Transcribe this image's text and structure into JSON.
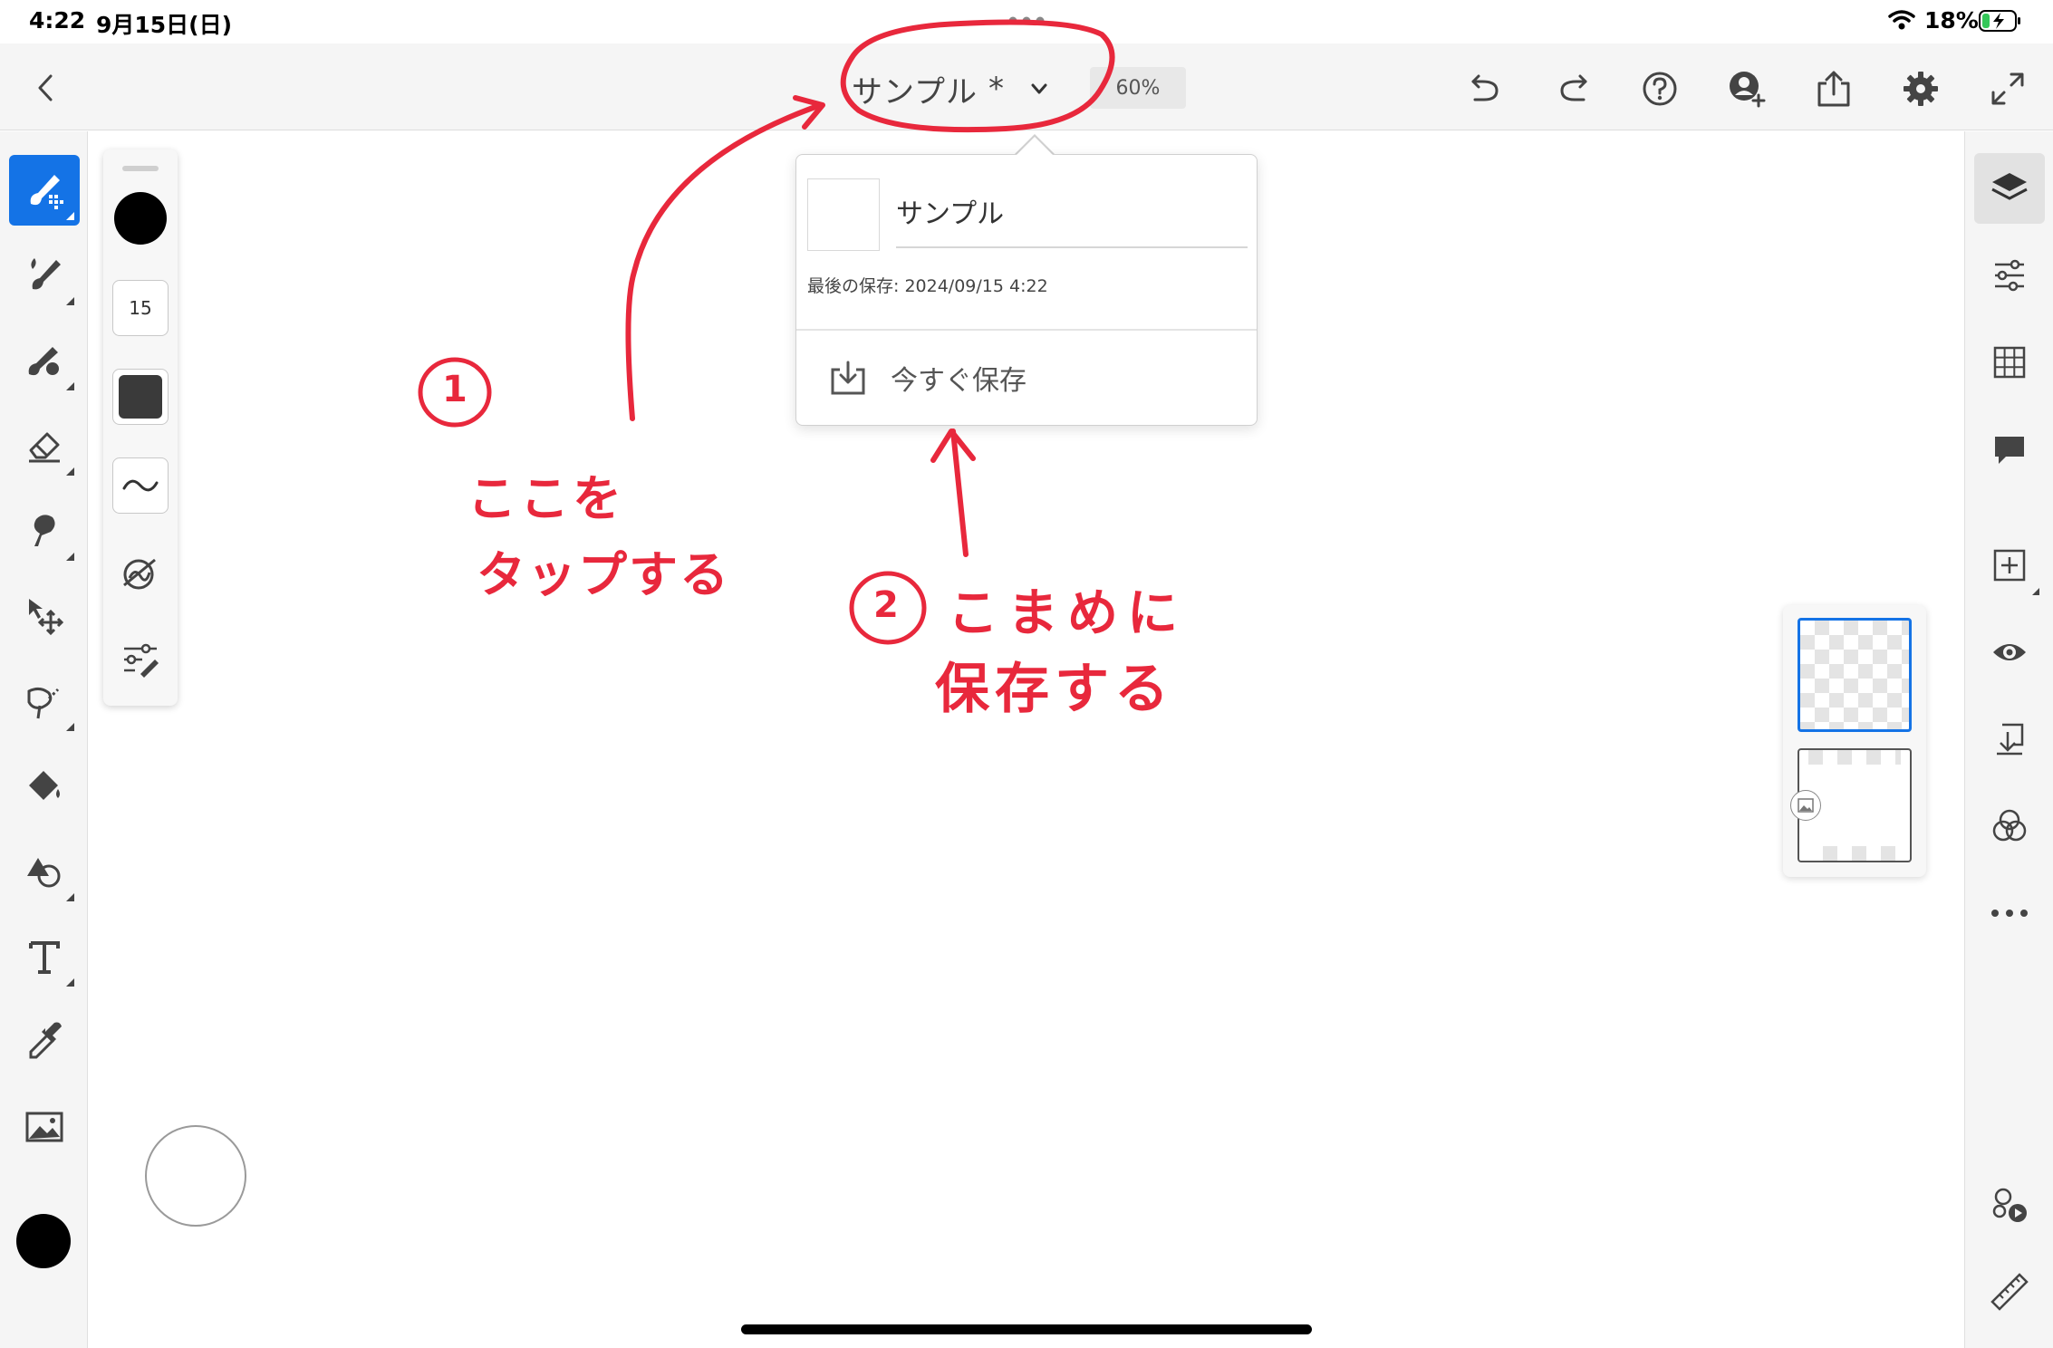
{
  "status_bar": {
    "time": "4:22",
    "date": "9月15日(日)",
    "battery_percent": "18%"
  },
  "toolbar": {
    "document_title": "サンプル",
    "modified_marker": "*",
    "zoom": "60%",
    "icons": [
      "back-icon",
      "undo-icon",
      "redo-icon",
      "help-icon",
      "invite-user-icon",
      "share-icon",
      "settings-icon",
      "fullscreen-icon"
    ]
  },
  "brush_panel": {
    "size_value": "15",
    "color": "#000000"
  },
  "save_popover": {
    "name": "サンプル",
    "last_saved": "最後の保存: 2024/09/15 4:22",
    "save_now_label": "今すぐ保存"
  },
  "left_tools": [
    "paint-brush",
    "live-brush",
    "pixel-brush",
    "eraser",
    "smudge",
    "transform",
    "selection",
    "fill",
    "shape",
    "text",
    "eyedropper",
    "image"
  ],
  "right_tools": [
    "layers",
    "layer-properties",
    "grid",
    "comments",
    "add-layer",
    "visibility",
    "merge-down",
    "blend-modes",
    "more-options",
    "libraries",
    "ruler"
  ],
  "annotations": {
    "step1_number": "1",
    "step1_line1": "ここを",
    "step1_line2": "タップする",
    "step2_number": "2",
    "step2_line1": "こまめに",
    "step2_line2": "保存する"
  },
  "colors": {
    "accent": "#1473e6",
    "annotation_red": "#e8283c",
    "toolbar_bg": "#f5f5f5"
  }
}
